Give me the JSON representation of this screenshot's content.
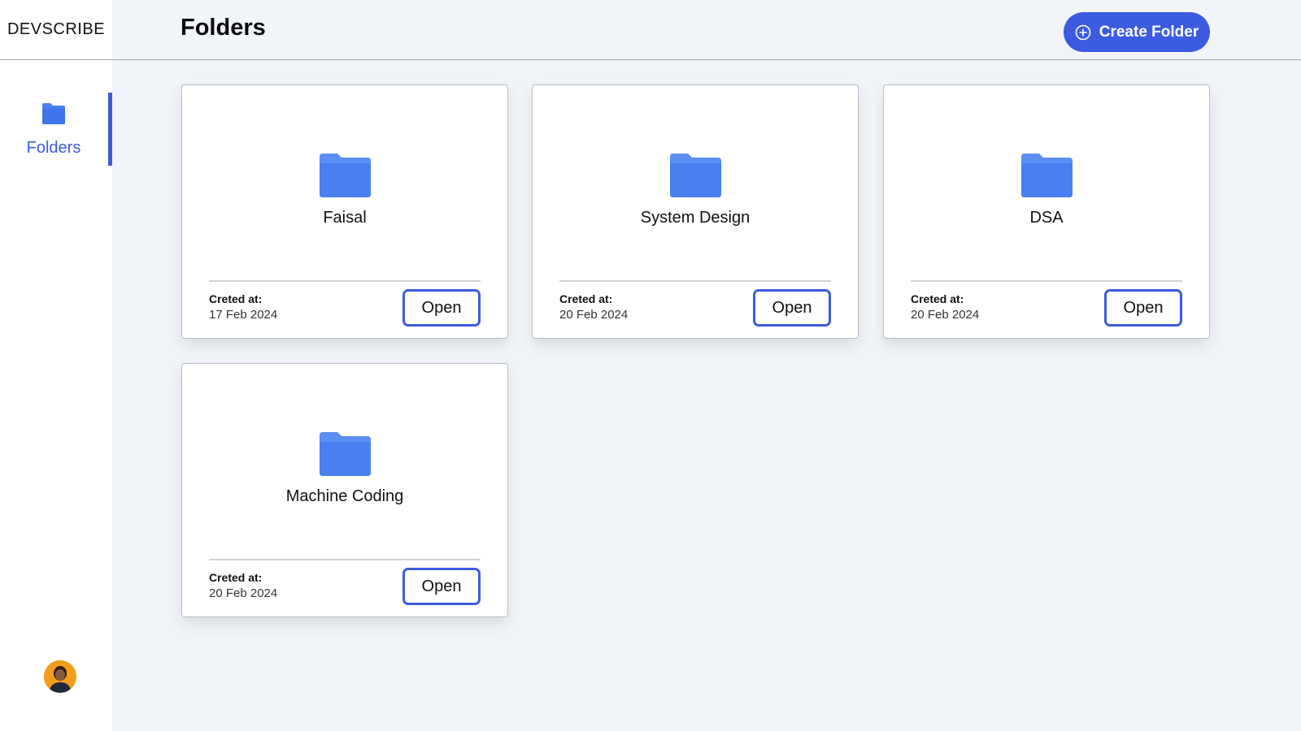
{
  "app": {
    "brand": "DEVSCRIBE"
  },
  "sidebar": {
    "items": [
      {
        "label": "Folders",
        "icon": "folder-icon",
        "active": true
      }
    ],
    "avatar": "user-avatar"
  },
  "header": {
    "title": "Folders",
    "create_button": {
      "label": "Create Folder",
      "icon": "plus-circle-icon"
    }
  },
  "folders": [
    {
      "name": "Faisal",
      "created_label": "Creted at:",
      "created_date": "17 Feb 2024",
      "open_label": "Open"
    },
    {
      "name": "System Design",
      "created_label": "Creted at:",
      "created_date": "20 Feb 2024",
      "open_label": "Open"
    },
    {
      "name": "DSA",
      "created_label": "Creted at:",
      "created_date": "20 Feb 2024",
      "open_label": "Open"
    },
    {
      "name": "Machine Coding",
      "created_label": "Creted at:",
      "created_date": "20 Feb 2024",
      "open_label": "Open"
    }
  ],
  "colors": {
    "accent": "#3d5be0",
    "folder": "#4a7ff0",
    "background": "#f1f4f8"
  }
}
